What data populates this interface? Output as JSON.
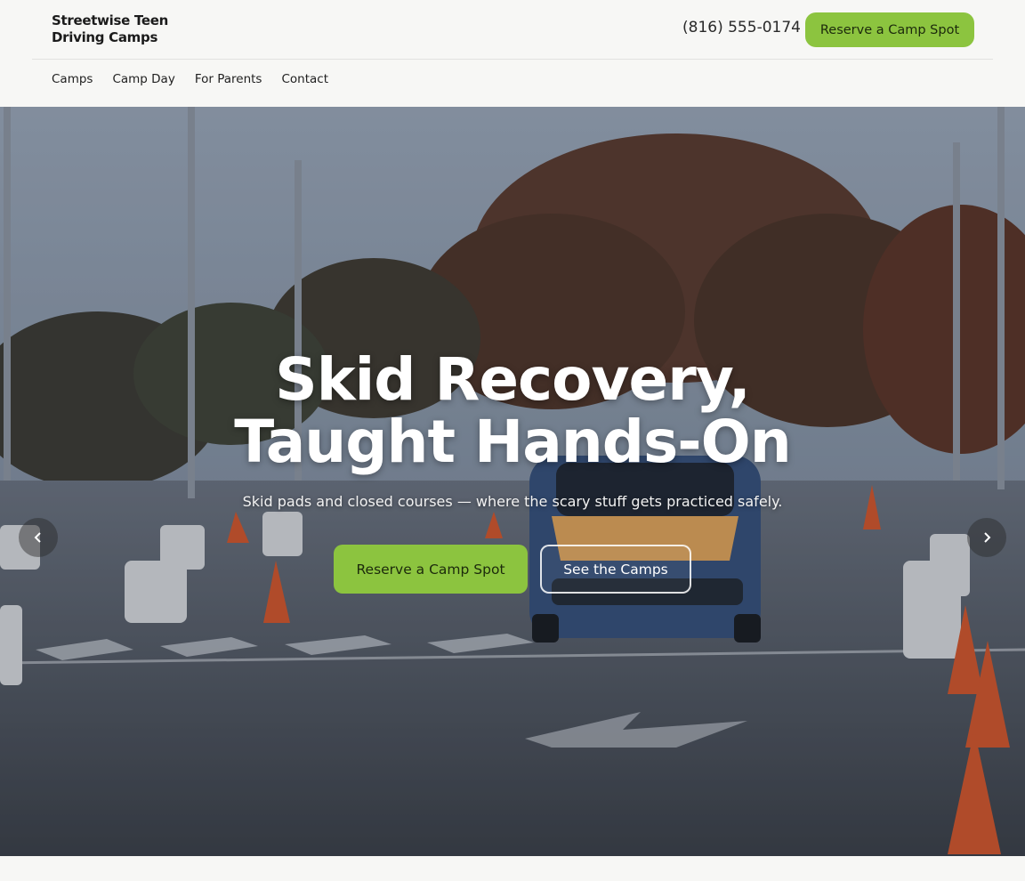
{
  "brand": {
    "name": "Streetwise Teen Driving Camps"
  },
  "header": {
    "phone": "(816) 555-0174",
    "cta_label": "Reserve a Camp Spot"
  },
  "nav": {
    "items": [
      {
        "label": "Camps"
      },
      {
        "label": "Camp Day"
      },
      {
        "label": "For Parents"
      },
      {
        "label": "Contact"
      }
    ]
  },
  "hero": {
    "title": "Skid Recovery, Taught Hands-On",
    "subtitle": "Skid pads and closed courses — where the scary stuff gets practiced safely.",
    "primary_cta": "Reserve a Camp Spot",
    "secondary_cta": "See the Camps",
    "prev_icon": "chevron-left-icon",
    "next_icon": "chevron-right-icon"
  },
  "colors": {
    "accent": "#8cc43f",
    "background": "#f7f7f5",
    "text": "#1f1f1f"
  }
}
